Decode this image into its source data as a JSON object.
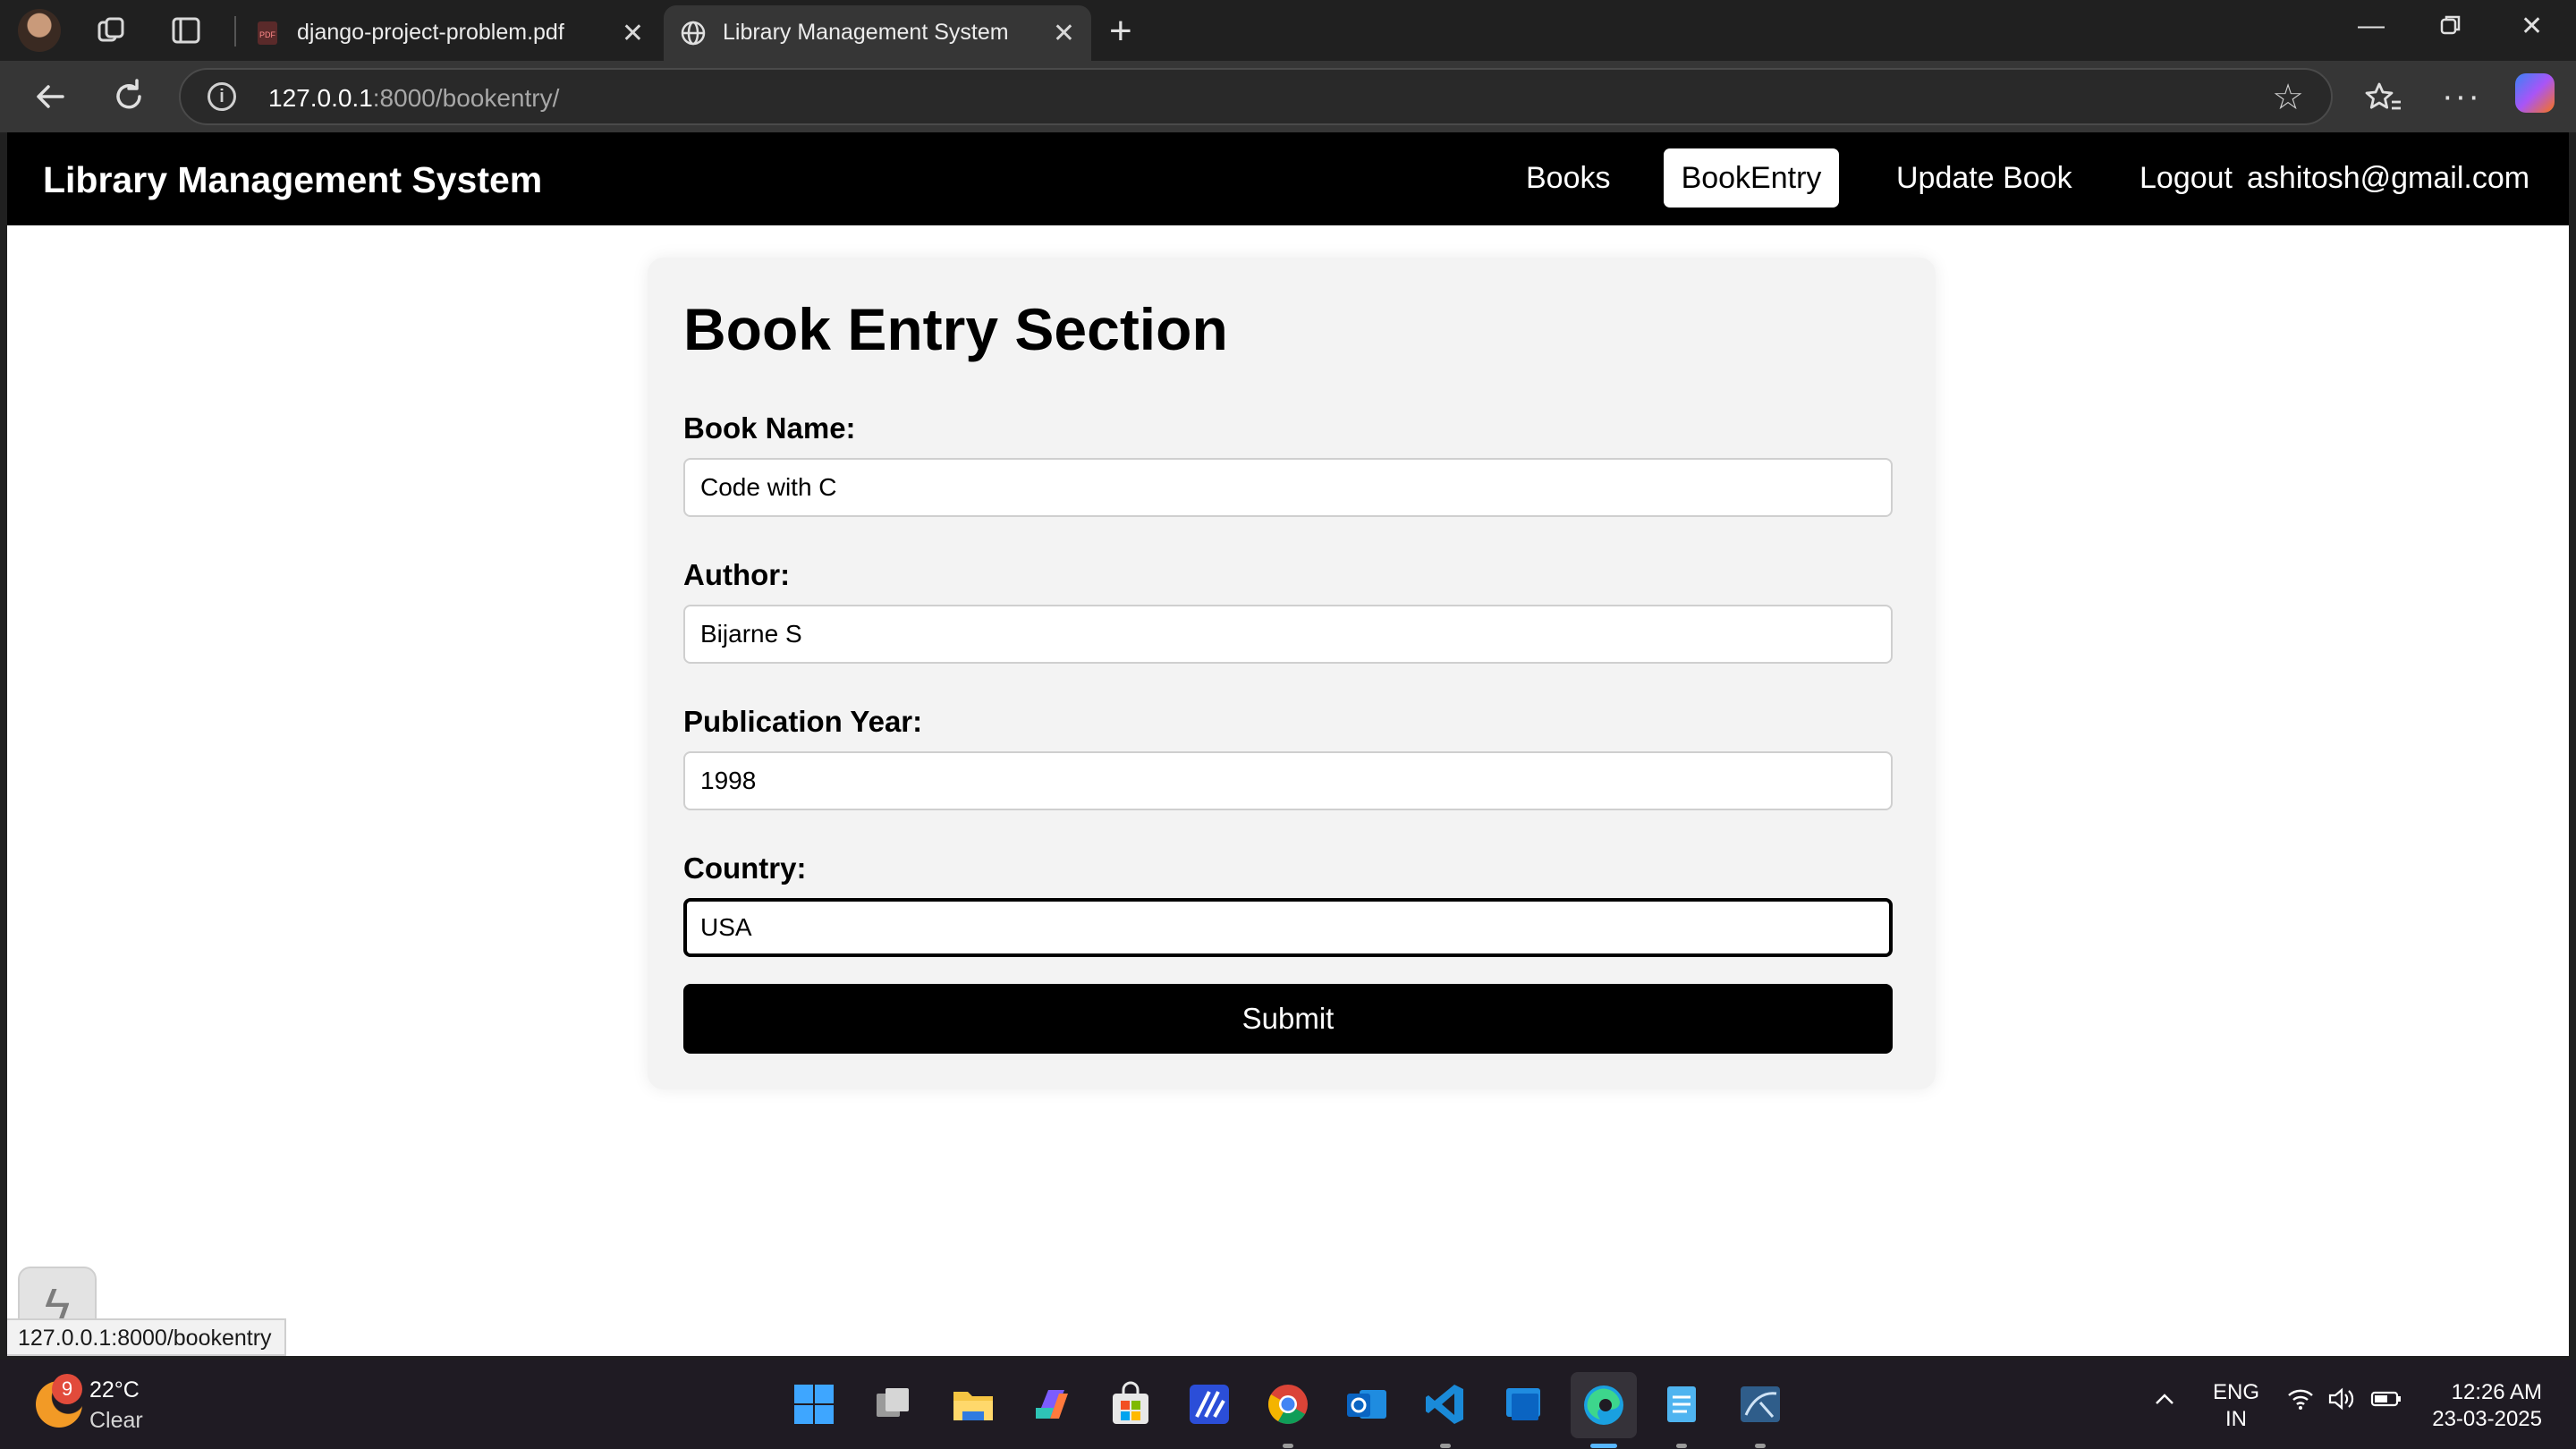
{
  "browser": {
    "tabs": [
      {
        "title": "django-project-problem.pdf"
      },
      {
        "title": "Library Management System"
      }
    ],
    "url_host": "127.0.0.1",
    "url_path": ":8000/bookentry/"
  },
  "site": {
    "brand": "Library Management System",
    "nav": {
      "books": "Books",
      "book_entry": "BookEntry",
      "update_book": "Update Book",
      "logout": "Logout",
      "user_email": "ashitosh@gmail.com"
    }
  },
  "form": {
    "heading": "Book Entry Section",
    "fields": [
      {
        "label": "Book Name:",
        "value": "Code with C"
      },
      {
        "label": "Author:",
        "value": "Bijarne S"
      },
      {
        "label": "Publication Year:",
        "value": "1998"
      },
      {
        "label": "Country:",
        "value": "USA"
      }
    ],
    "submit_label": "Submit"
  },
  "status_bar_url": "127.0.0.1:8000/bookentry",
  "taskbar": {
    "weather_badge": "9",
    "temperature": "22°C",
    "condition": "Clear",
    "lang_line1": "ENG",
    "lang_line2": "IN",
    "time": "12:26 AM",
    "date": "23-03-2025"
  }
}
